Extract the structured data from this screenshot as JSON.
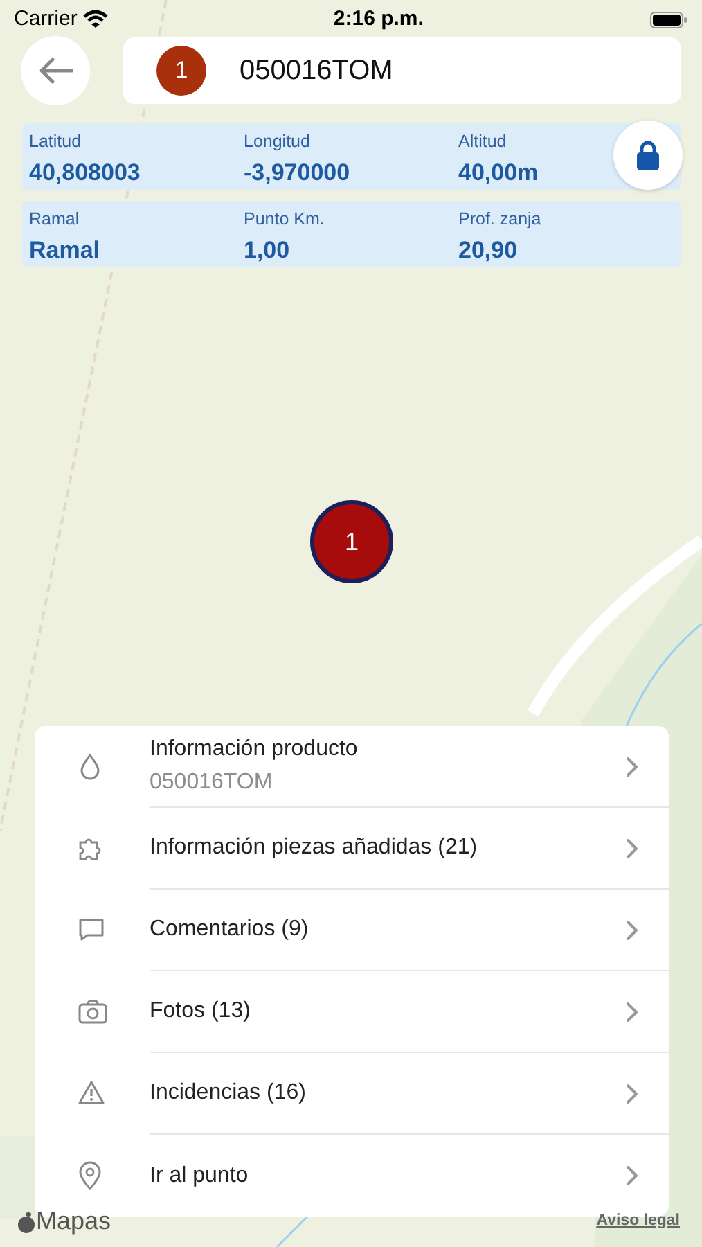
{
  "status_bar": {
    "carrier": "Carrier",
    "time": "2:16 p.m."
  },
  "header": {
    "badge": "1",
    "title": "050016TOM"
  },
  "info_rows": [
    {
      "fields": [
        {
          "label": "Latitud",
          "value": "40,808003"
        },
        {
          "label": "Longitud",
          "value": "-3,970000"
        },
        {
          "label": "Altitud",
          "value": "40,00m"
        }
      ],
      "lock": true
    },
    {
      "fields": [
        {
          "label": "Ramal",
          "value": "Ramal"
        },
        {
          "label": "Punto Km.",
          "value": "1,00"
        },
        {
          "label": "Prof. zanja",
          "value": "20,90"
        }
      ],
      "lock": false
    }
  ],
  "map": {
    "kind": "picture",
    "marker": "1"
  },
  "menu": [
    {
      "kind": "drop",
      "title": "Información producto",
      "subtitle": "050016TOM"
    },
    {
      "kind": "puzzle",
      "title": "Información piezas añadidas (21)"
    },
    {
      "kind": "comment",
      "title": "Comentarios (9)"
    },
    {
      "kind": "camera",
      "title": "Fotos (13)"
    },
    {
      "kind": "warning",
      "title": "Incidencias (16)"
    },
    {
      "kind": "pin",
      "title": "Ir al punto"
    }
  ],
  "footer": {
    "brand": "Mapas",
    "legal": "Aviso legal"
  }
}
